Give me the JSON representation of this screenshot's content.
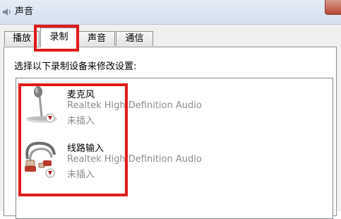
{
  "window": {
    "title": "声音"
  },
  "tabs": [
    {
      "label": "播放"
    },
    {
      "label": "录制",
      "active": true
    },
    {
      "label": "声音"
    },
    {
      "label": "通信"
    }
  ],
  "panel": {
    "instruction": "选择以下录制设备来修改设置:"
  },
  "devices": [
    {
      "name": "麦克风",
      "driver": "Realtek High Definition Audio",
      "status": "未插入",
      "icon": "microphone-icon"
    },
    {
      "name": "线路输入",
      "driver": "Realtek High Definition Audio",
      "status": "未插入",
      "icon": "line-in-cable-icon"
    }
  ],
  "colors": {
    "highlight": "#e11b1b",
    "status_badge": "#c0141b",
    "disabled_text": "#8c8c8c"
  }
}
